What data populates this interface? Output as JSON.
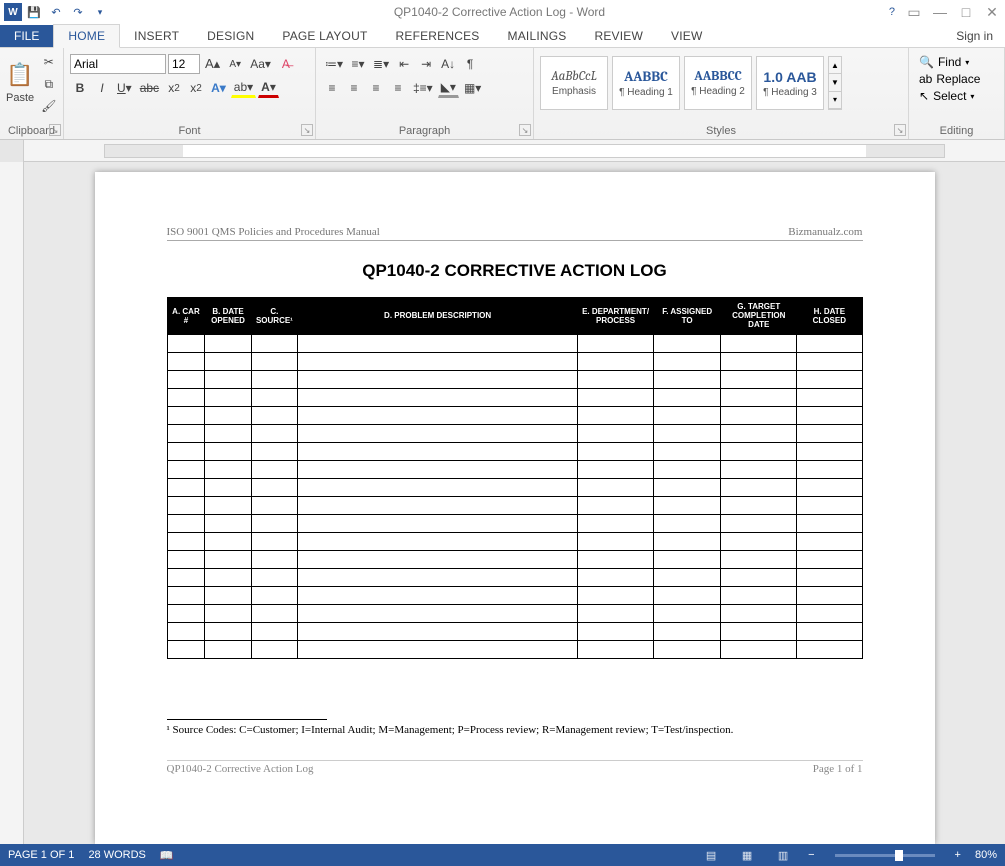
{
  "titlebar": {
    "title": "QP1040-2 Corrective Action Log - Word"
  },
  "tabs": {
    "file": "FILE",
    "home": "HOME",
    "insert": "INSERT",
    "design": "DESIGN",
    "pagelayout": "PAGE LAYOUT",
    "references": "REFERENCES",
    "mailings": "MAILINGS",
    "review": "REVIEW",
    "view": "VIEW",
    "signin": "Sign in"
  },
  "ribbon": {
    "clipboard": {
      "label": "Clipboard",
      "paste": "Paste"
    },
    "font": {
      "label": "Font",
      "name": "Arial",
      "size": "12"
    },
    "paragraph": {
      "label": "Paragraph"
    },
    "styles": {
      "label": "Styles",
      "items": [
        {
          "preview": "AaBbCcL",
          "name": "Emphasis"
        },
        {
          "preview": "AABBC",
          "name": "¶ Heading 1"
        },
        {
          "preview": "AABBCC",
          "name": "¶ Heading 2"
        },
        {
          "preview": "1.0  AAB",
          "name": "¶ Heading 3"
        }
      ]
    },
    "editing": {
      "label": "Editing",
      "find": "Find",
      "replace": "Replace",
      "select": "Select"
    }
  },
  "doc": {
    "header_left": "ISO 9001 QMS Policies and Procedures Manual",
    "header_right": "Bizmanualz.com",
    "title": "QP1040-2 CORRECTIVE ACTION LOG",
    "columns": [
      "A. CAR #",
      "B. DATE OPENED",
      "C. SOURCE¹",
      "D. PROBLEM DESCRIPTION",
      "E. DEPARTMENT/ PROCESS",
      "F. ASSIGNED TO",
      "G. TARGET COMPLETION DATE",
      "H. DATE CLOSED"
    ],
    "row_count": 18,
    "footnote": "¹ Source Codes: C=Customer; I=Internal Audit; M=Management; P=Process review; R=Management review; T=Test/inspection.",
    "footer_left": "QP1040-2 Corrective Action Log",
    "footer_right": "Page 1 of 1"
  },
  "status": {
    "page": "PAGE 1 OF 1",
    "words": "28 WORDS",
    "zoom": "80%"
  }
}
